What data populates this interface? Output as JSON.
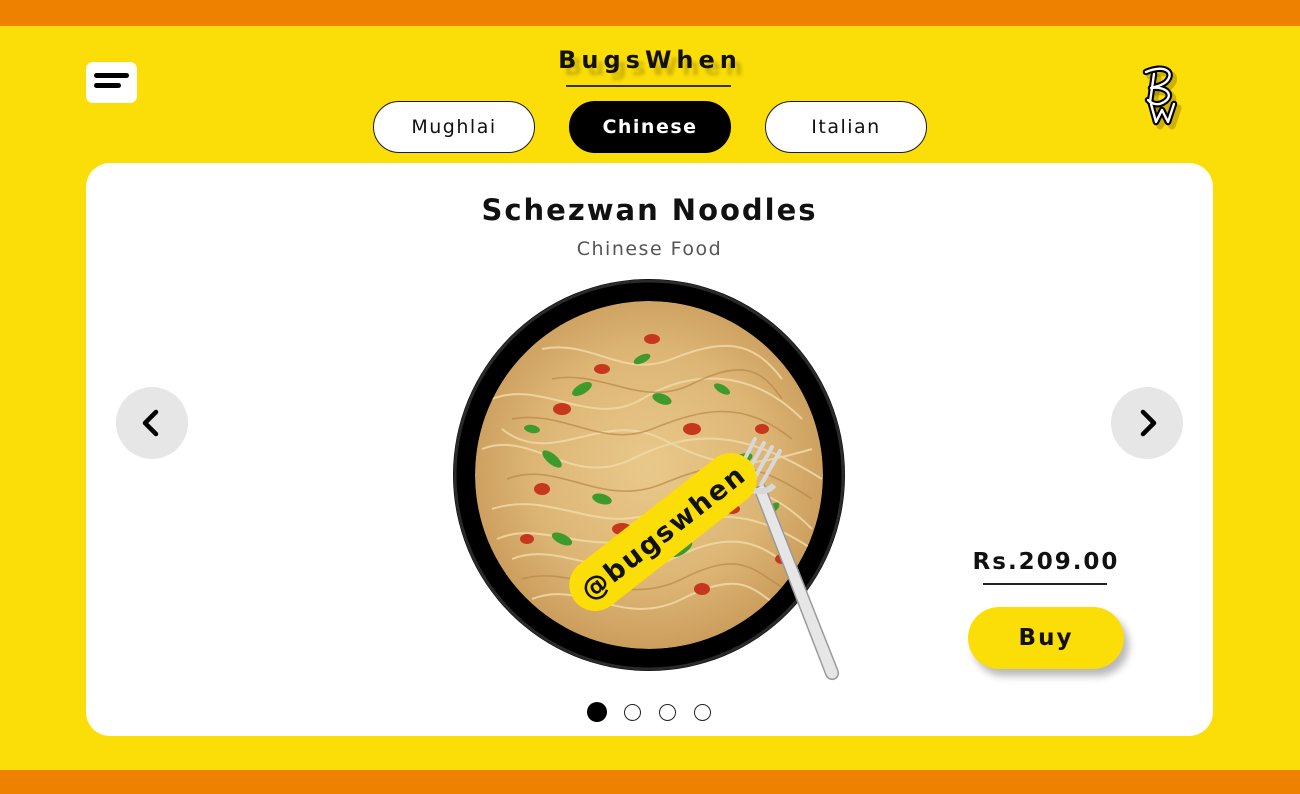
{
  "brand": {
    "name": "BugsWhen"
  },
  "icons": {
    "menu": "hamburger-menu-icon",
    "logo": "bw-monogram-logo",
    "prev": "chevron-left-icon",
    "next": "chevron-right-icon"
  },
  "tabs": [
    {
      "label": "Mughlai",
      "active": false
    },
    {
      "label": "Chinese",
      "active": true
    },
    {
      "label": "Italian",
      "active": false
    }
  ],
  "product": {
    "name": "Schezwan Noodles",
    "category": "Chinese Food",
    "image_overlay_text": "@bugswhen",
    "price": "Rs.209.00",
    "buy_label": "Buy"
  },
  "carousel": {
    "total": 4,
    "active_index": 0
  },
  "colors": {
    "background": "#FBDD07",
    "band": "#EF8100",
    "card": "#FFFFFF",
    "active_tab": "#000000",
    "buy_button": "#FBDD07"
  }
}
